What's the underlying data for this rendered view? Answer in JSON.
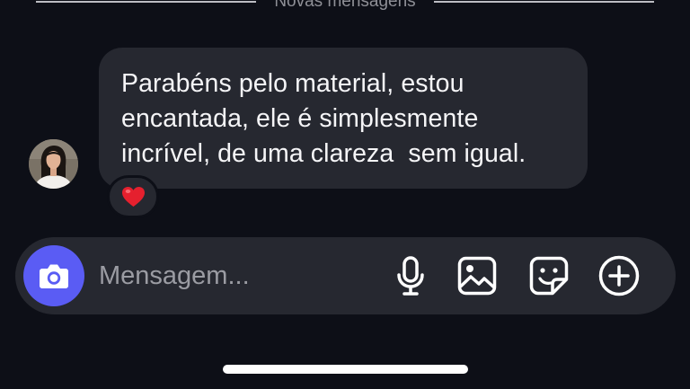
{
  "divider": {
    "label": "Novas mensagens"
  },
  "message": {
    "lines": [
      "Parabéns pelo material, estou",
      "encantada, ele é simplesmente",
      "incrível, de uma clareza  sem igual."
    ],
    "reaction": "❤️"
  },
  "composer": {
    "placeholder": "Mensagem...",
    "icons": [
      "camera-icon",
      "microphone-icon",
      "image-icon",
      "sticker-icon",
      "plus-icon"
    ]
  },
  "colors": {
    "background": "#0d0f17",
    "bubble": "#262830",
    "camera_button": "#5a5cf4"
  }
}
